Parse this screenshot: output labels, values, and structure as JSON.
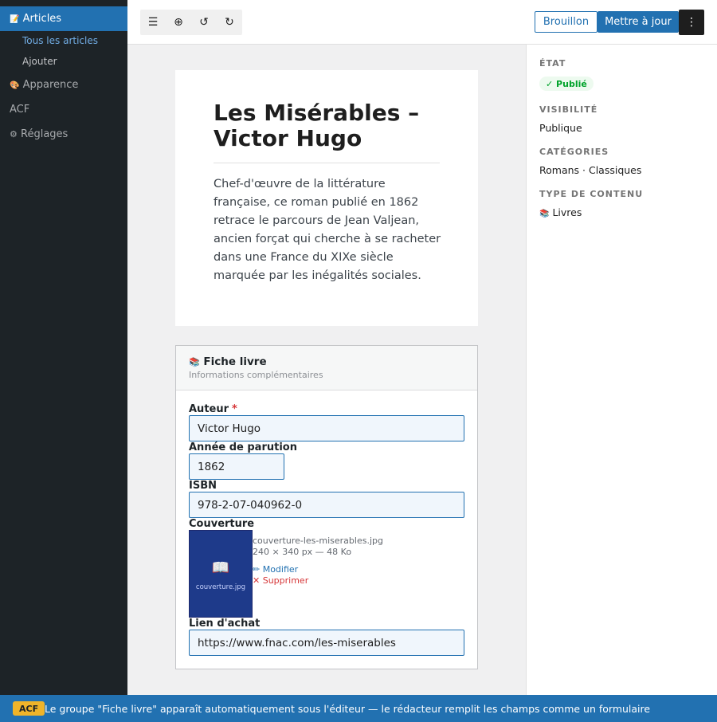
{
  "sidebar": {
    "active": {
      "icon": "📝",
      "label": "Articles"
    },
    "sub_items": [
      "Tous les articles",
      "Ajouter"
    ],
    "items": [
      {
        "icon": "🎨",
        "label": "Apparence"
      },
      {
        "icon": "",
        "label": "ACF"
      },
      {
        "icon": "⚙",
        "label": "Réglages"
      }
    ]
  },
  "toolbar": {
    "icons": {
      "list": "☰",
      "insert": "⊕",
      "undo": "↺",
      "redo": "↻"
    },
    "draft_label": "Brouillon",
    "update_label": "Mettre à jour",
    "more_icon": "⋮"
  },
  "post": {
    "title": "Les Misérables – Victor Hugo",
    "excerpt": "Chef-d'œuvre de la littérature française, ce roman publié en 1862 retrace le parcours de Jean Valjean, ancien forçat qui cherche à se racheter dans une France du XIXe siècle marquée par les inégalités sociales."
  },
  "acf": {
    "icon": "📚",
    "title": "Fiche livre",
    "subtitle": "Informations complémentaires",
    "fields": {
      "author": {
        "label": "Auteur",
        "required_mark": "*",
        "value": "Victor Hugo"
      },
      "year": {
        "label": "Année de parution",
        "value": "1862"
      },
      "isbn": {
        "label": "ISBN",
        "value": "978-2-07-040962-0"
      },
      "cover": {
        "label": "Couverture",
        "thumb_icon": "📖",
        "thumb_caption": "couverture.jpg",
        "file_name": "couverture-les-miserables.jpg",
        "file_meta": "240 × 340 px — 48 Ko",
        "edit_label": "✏ Modifier",
        "delete_label": "✕ Supprimer"
      },
      "link": {
        "label": "Lien d'achat",
        "value": "https://www.fnac.com/les-miserables"
      }
    }
  },
  "panel": {
    "status": {
      "heading": "ÉTAT",
      "badge": "✓ Publié"
    },
    "visibility": {
      "heading": "VISIBILITÉ",
      "value": "Publique"
    },
    "categories": {
      "heading": "CATÉGORIES",
      "value": "Romans · Classiques"
    },
    "content_type": {
      "heading": "TYPE DE CONTENU",
      "icon": "📚",
      "value": "Livres"
    }
  },
  "footer": {
    "badge": "ACF",
    "text": "Le groupe \"Fiche livre\" apparaît automatiquement sous l'éditeur — le rédacteur remplit les champs comme un formulaire"
  },
  "colors": {
    "accent": "#2271b1",
    "sidebar": "#1d2327",
    "published": "#00a32a",
    "danger": "#d63638",
    "acf_badge": "#f0b429",
    "cover": "#1e3a8a"
  }
}
